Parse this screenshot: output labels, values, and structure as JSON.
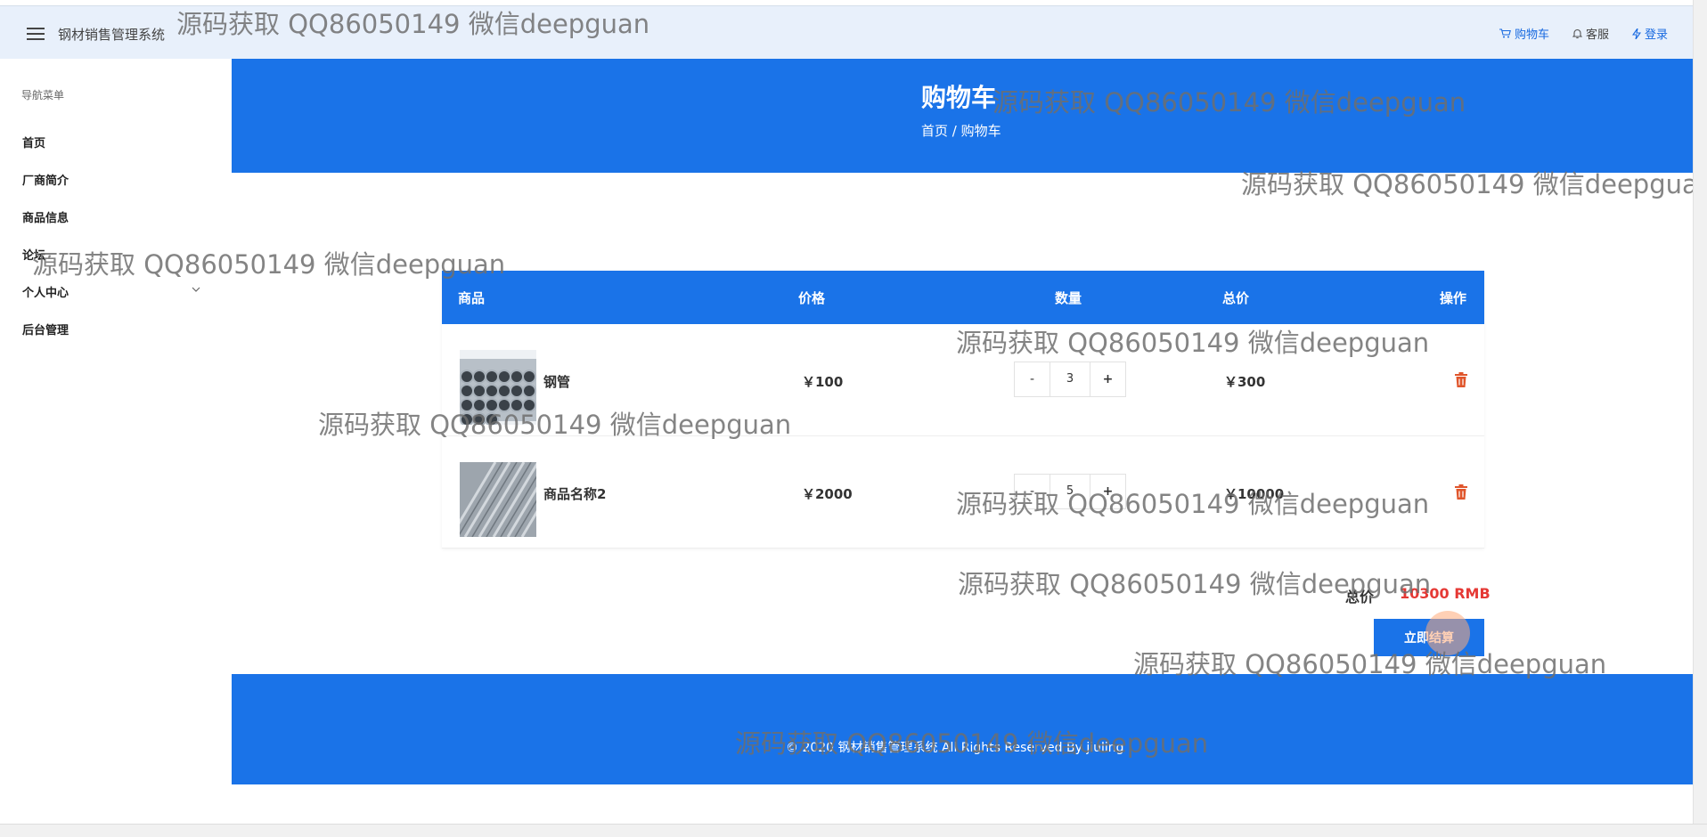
{
  "header": {
    "app_title": "钢材销售管理系统",
    "links": [
      {
        "label": "购物车",
        "icon": "cart-icon"
      },
      {
        "label": "客服",
        "icon": "bell-icon"
      },
      {
        "label": "登录",
        "icon": "bolt-icon"
      }
    ]
  },
  "sidebar": {
    "title": "导航菜单",
    "items": [
      {
        "label": "首页"
      },
      {
        "label": "厂商简介"
      },
      {
        "label": "商品信息"
      },
      {
        "label": "论坛"
      },
      {
        "label": "个人中心"
      },
      {
        "label": "后台管理"
      }
    ]
  },
  "hero": {
    "title": "购物车",
    "breadcrumb_home": "首页",
    "breadcrumb_sep": "/",
    "breadcrumb_current": "购物车"
  },
  "cart": {
    "columns": [
      "商品",
      "价格",
      "数量",
      "总价",
      "操作"
    ],
    "rows": [
      {
        "name": "钢管",
        "price": "￥100",
        "qty": "3",
        "total": "￥300",
        "minus": "-",
        "plus": "+"
      },
      {
        "name": "商品名称2",
        "price": "￥2000",
        "qty": "5",
        "total": "￥10000",
        "minus": "-",
        "plus": "+"
      }
    ],
    "sum_label": "总价",
    "sum_value": "10300 RMB",
    "checkout_label": "立即结算"
  },
  "footer": {
    "text": "© 2020 钢材销售管理系统 All Rights Reserved By jiuling"
  },
  "watermark": "源码获取 QQ86050149 微信deepguan",
  "colors": {
    "primary": "#1a73e8",
    "topbar": "#e8f0fb",
    "danger": "#e53935",
    "delete_icon": "#e0552b"
  }
}
